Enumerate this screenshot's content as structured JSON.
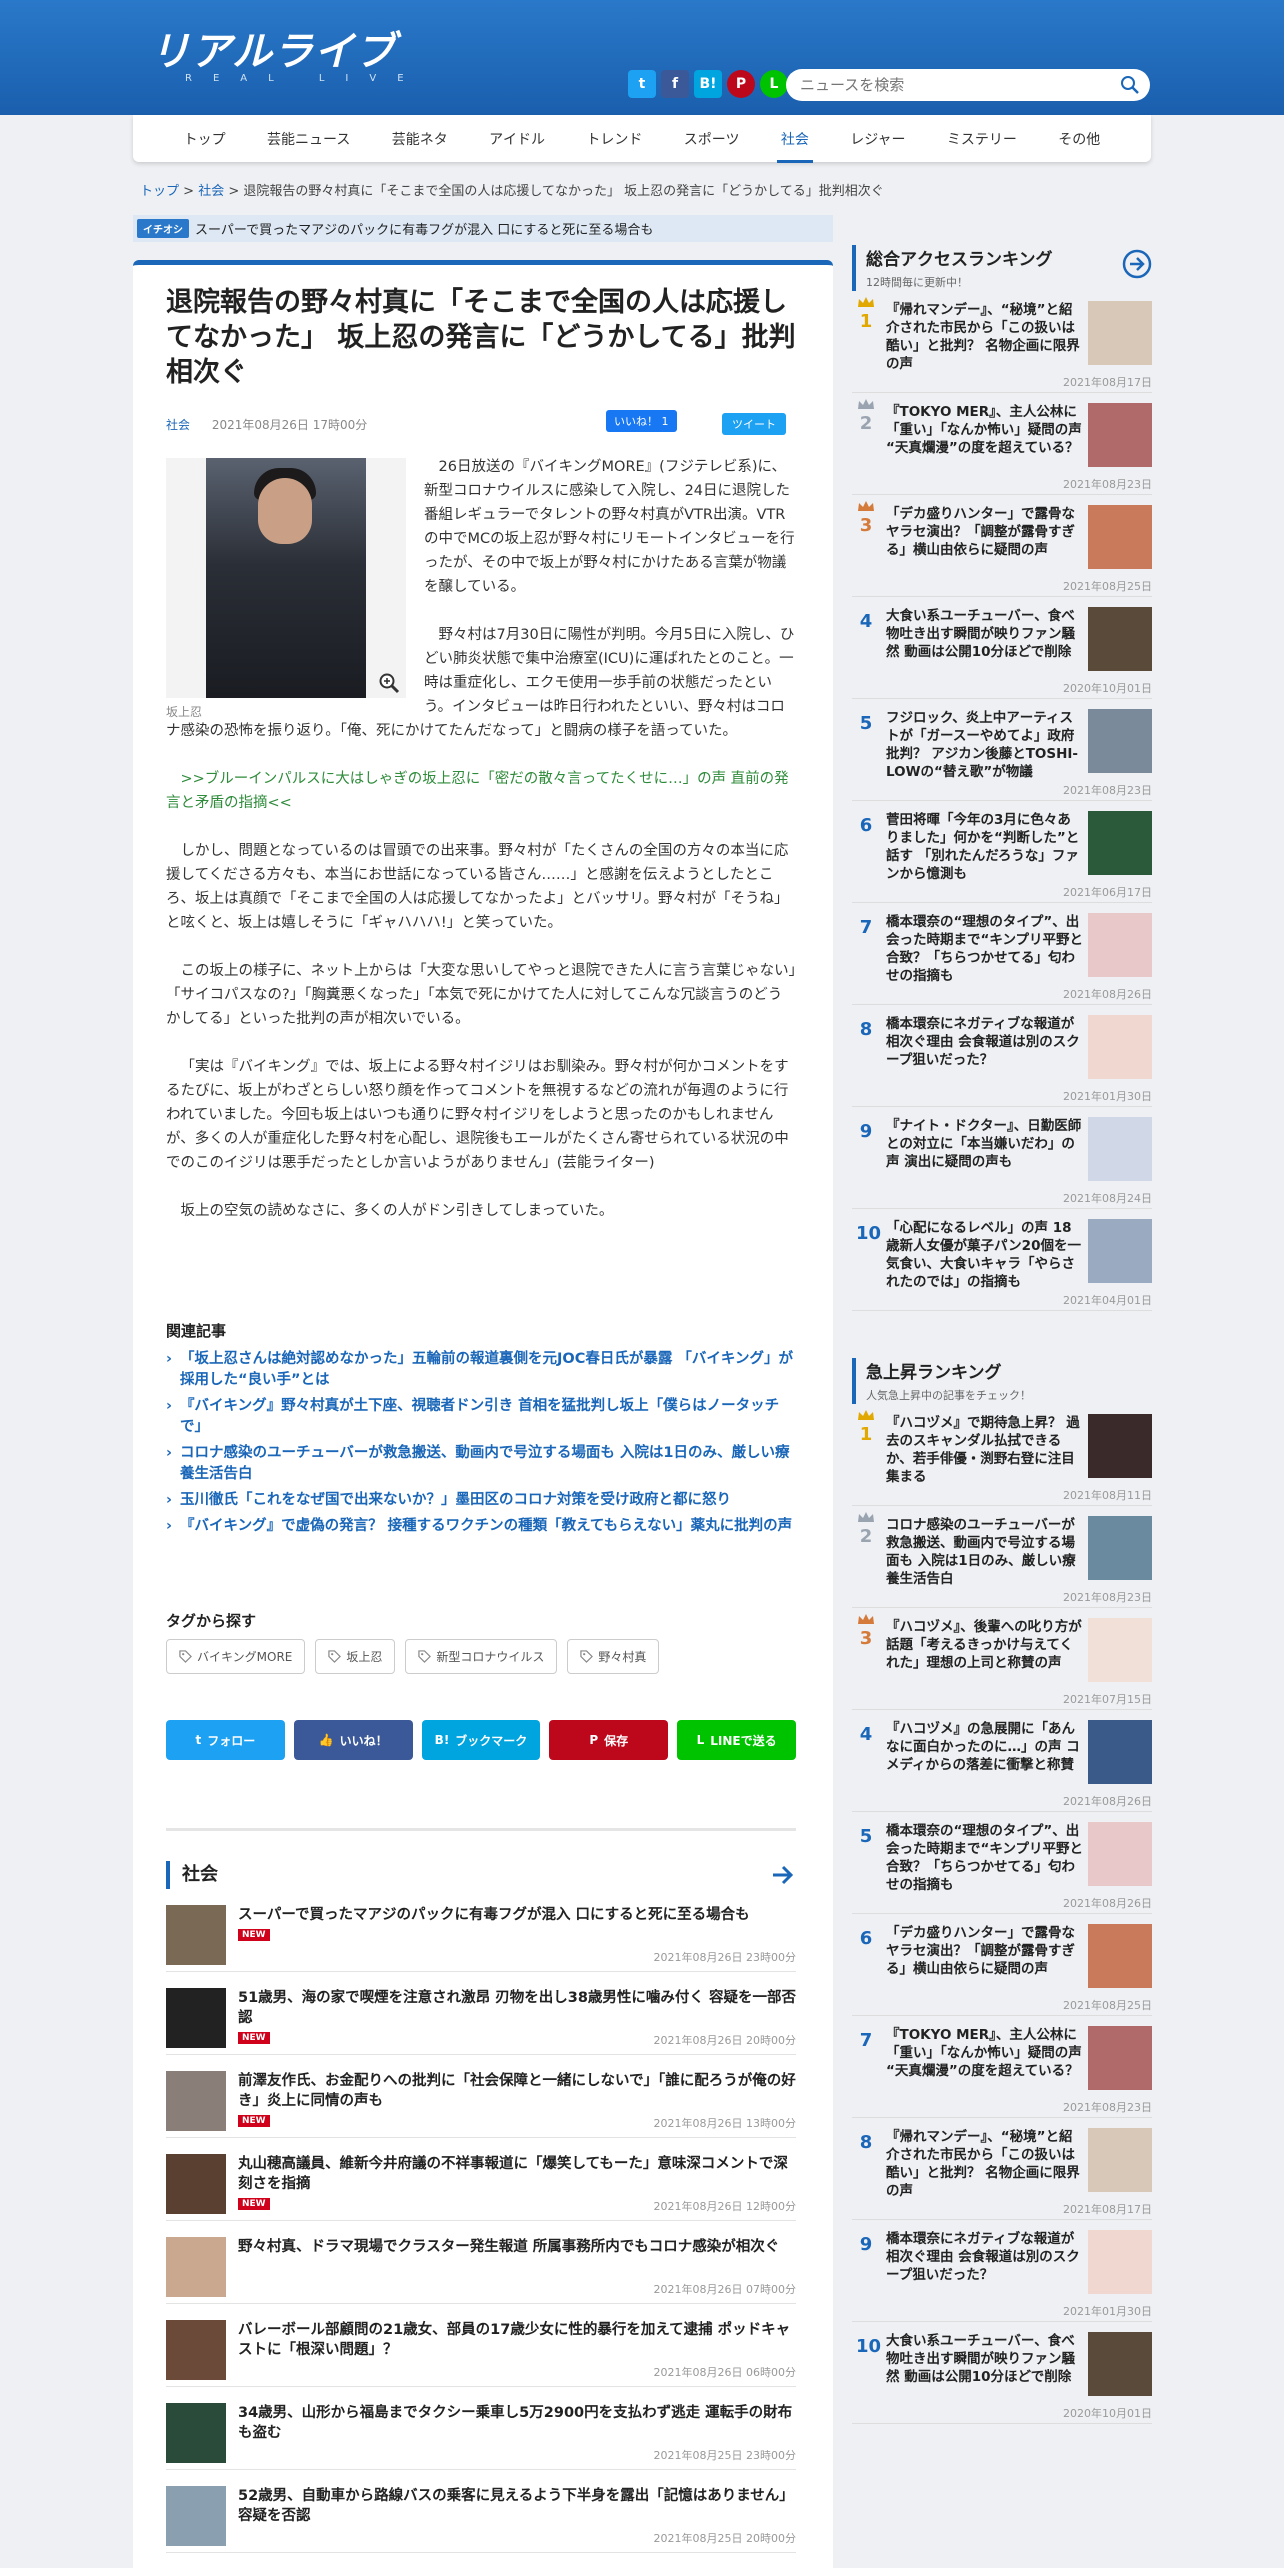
{
  "site": {
    "logo": "リアルライブ",
    "logo_sub": "REAL LIVE"
  },
  "search": {
    "placeholder": "ニュースを検索"
  },
  "social_top": [
    {
      "name": "twitter",
      "glyph": "t",
      "color": "#1da1f2"
    },
    {
      "name": "facebook",
      "glyph": "f",
      "color": "#3b5998"
    },
    {
      "name": "hatena",
      "glyph": "B!",
      "color": "#00a4de"
    },
    {
      "name": "pinterest",
      "glyph": "P",
      "color": "#bd081c"
    },
    {
      "name": "line",
      "glyph": "L",
      "color": "#00c300"
    }
  ],
  "nav": [
    "トップ",
    "芸能ニュース",
    "芸能ネタ",
    "アイドル",
    "トレンド",
    "スポーツ",
    "社会",
    "レジャー",
    "ミステリー",
    "その他"
  ],
  "nav_active": 6,
  "breadcrumb": {
    "top": "トップ",
    "sep1": " > ",
    "section": "社会",
    "sep2": " > ",
    "current": "退院報告の野々村真に「そこまで全国の人は応援してなかった」 坂上忍の発言に「どうかしてる」批判相次ぐ"
  },
  "pickup": {
    "label": "イチオシ",
    "text": "スーパーで買ったマアジのパックに有毒フグが混入 口にすると死に至る場合も"
  },
  "article": {
    "title": "退院報告の野々村真に「そこまで全国の人は応援してなかった」 坂上忍の発言に「どうかしてる」批判相次ぐ",
    "category": "社会",
    "date": "2021年08月26日 17時00分",
    "like_label": "いいね！ 1",
    "tweet_label": "ツイート",
    "photo_caption": "坂上忍",
    "paragraphs": [
      "26日放送の『バイキングMORE』(フジテレビ系)に、新型コロナウイルスに感染して入院し、24日に退院した番組レギュラーでタレントの野々村真がVTR出演。VTRの中でMCの坂上忍が野々村にリモートインタビューを行ったが、その中で坂上が野々村にかけたある言葉が物議を醸している。",
      "野々村は7月30日に陽性が判明。今月5日に入院し、ひどい肺炎状態で集中治療室(ICU)に運ばれたとのこと。一時は重症化し、エクモ使用一歩手前の状態だったという。インタビューは昨日行われたといい、野々村はコロナ感染の恐怖を振り返り。「俺、死にかけてたんだなって」と闘病の様子を語っていた。",
      "しかし、問題となっているのは冒頭での出来事。野々村が「たくさんの全国の方々の本当に応援してくださる方々も、本当にお世話になっている皆さん……」と感謝を伝えようとしたところ、坂上は真顔で「そこまで全国の人は応援してなかったよ」とバッサリ。野々村が「そうね」と呟くと、坂上は嬉しそうに「ギャハハハ!」と笑っていた。",
      "この坂上の様子に、ネット上からは「大変な思いしてやっと退院できた人に言う言葉じゃない」「サイコパスなの?」「胸糞悪くなった」「本気で死にかけてた人に対してこんな冗談言うのどうかしてる」といった批判の声が相次いでいる。",
      "「実は『バイキング』では、坂上による野々村イジリはお馴染み。野々村が何かコメントをするたびに、坂上がわざとらしい怒り顔を作ってコメントを無視するなどの流れが毎週のように行われていました。今回も坂上はいつも通りに野々村イジリをしようと思ったのかもしれませんが、多くの人が重症化した野々村を心配し、退院後もエールがたくさん寄せられている状況の中でのこのイジリは悪手だったとしか言いようがありません」(芸能ライター)",
      "坂上の空気の読めなさに、多くの人がドン引きしてしまっていた。"
    ],
    "inline_link": ">>ブルーインパルスに大はしゃぎの坂上忍に「密だの散々言ってたくせに…」の声 直前の発言と矛盾の指摘<<"
  },
  "related": {
    "heading": "関連記事",
    "items": [
      "「坂上忍さんは絶対認めなかった」五輪前の報道裏側を元JOC春日氏が暴露 「バイキング」が採用した“良い手”とは",
      "『バイキング』野々村真が土下座、視聴者ドン引き 首相を猛批判し坂上「僕らはノータッチで」",
      "コロナ感染のユーチューバーが救急搬送、動画内で号泣する場面も 入院は1日のみ、厳しい療養生活告白",
      "玉川徹氏「これをなぜ国で出来ないか？」墨田区のコロナ対策を受け政府と都に怒り",
      "『バイキング』で虚偽の発言？ 接種するワクチンの種類「教えてもらえない」薬丸に批判の声"
    ]
  },
  "tags": {
    "heading": "タグから探す",
    "items": [
      "バイキングMORE",
      "坂上忍",
      "新型コロナウイルス",
      "野々村真"
    ]
  },
  "share": [
    {
      "label": "フォロー",
      "color": "#1da1f2",
      "icon": "twitter-icon",
      "glyph": "t"
    },
    {
      "label": "いいね！",
      "color": "#3b5998",
      "icon": "thumbs-up-icon",
      "glyph": "👍"
    },
    {
      "label": "ブックマーク",
      "color": "#00a4de",
      "icon": "hatena-icon",
      "glyph": "B!"
    },
    {
      "label": "保存",
      "color": "#bd081c",
      "icon": "pinterest-icon",
      "glyph": "P"
    },
    {
      "label": "LINEで送る",
      "color": "#00c300",
      "icon": "line-icon",
      "glyph": "L"
    }
  ],
  "section": {
    "heading": "社会",
    "items": [
      {
        "title": "スーパーで買ったマアジのパックに有毒フグが混入 口にすると死に至る場合も",
        "date": "2021年08月26日 23時00分",
        "new": "NEW",
        "color": "#7a6a55"
      },
      {
        "title": "51歳男、海の家で喫煙を注意され激昂 刃物を出し38歳男性に噛み付く 容疑を一部否認",
        "date": "2021年08月26日 20時00分",
        "new": "NEW",
        "color": "#222222"
      },
      {
        "title": "前澤友作氏、お金配りへの批判に「社会保障と一緒にしないで」「誰に配ろうが俺の好き」炎上に同情の声も",
        "date": "2021年08月26日 13時00分",
        "new": "NEW",
        "color": "#8a7f78"
      },
      {
        "title": "丸山穂高議員、維新今井府議の不祥事報道に「爆笑してもーた」意味深コメントで深刻さを指摘",
        "date": "2021年08月26日 12時00分",
        "new": "NEW",
        "color": "#5a4030"
      },
      {
        "title": "野々村真、ドラマ現場でクラスター発生報道 所属事務所内でもコロナ感染が相次ぐ",
        "date": "2021年08月26日 07時00分",
        "new": "",
        "color": "#c9a88f"
      },
      {
        "title": "バレーボール部顧問の21歳女、部員の17歳少女に性的暴行を加えて逮捕 ポッドキャストに「根深い問題」？",
        "date": "2021年08月26日 06時00分",
        "new": "",
        "color": "#6b4a3a"
      },
      {
        "title": "34歳男、山形から福島までタクシー乗車し5万2900円を支払わず逃走 運転手の財布も盗む",
        "date": "2021年08月25日 23時00分",
        "new": "",
        "color": "#2a4a3a"
      },
      {
        "title": "52歳男、自動車から路線バスの乗客に見えるよう下半身を露出「記憶はありません」容疑を否認",
        "date": "2021年08月25日 20時00分",
        "new": "",
        "color": "#8aa0b0"
      }
    ]
  },
  "ranking_access": {
    "title": "総合アクセスランキング",
    "subtitle": "12時間毎に更新中！",
    "items": [
      {
        "rank": "1",
        "title": "『帰れマンデー』、“秘境”と紹介された市民から「この扱いは酷い」と批判？ 名物企画に限界の声",
        "date": "2021年08月17日",
        "color": "#d8c8b8"
      },
      {
        "rank": "2",
        "title": "『TOKYO MER』、主人公林に「重い」「なんか怖い」疑問の声 “天真爛漫”の度を超えている？",
        "date": "2021年08月23日",
        "color": "#b06a6a"
      },
      {
        "rank": "3",
        "title": "「デカ盛りハンター」で露骨なヤラセ演出？「調整が露骨すぎる」横山由依らに疑問の声",
        "date": "2021年08月25日",
        "color": "#c87a5a"
      },
      {
        "rank": "4",
        "title": "大食い系ユーチューバー、食べ物吐き出す瞬間が映りファン騒然 動画は公開10分ほどで削除",
        "date": "2020年10月01日",
        "color": "#5a4a3a"
      },
      {
        "rank": "5",
        "title": "フジロック、炎上中アーティストが「ガースーやめてよ」政府批判？ アジカン後藤とTOSHI-LOWの“替え歌”が物議",
        "date": "2021年08月23日",
        "color": "#7a8a9a"
      },
      {
        "rank": "6",
        "title": "菅田将暉「今年の3月に色々ありました」何かを“判断した”と話す 「別れたんだろうな」ファンから憶測も",
        "date": "2021年06月17日",
        "color": "#2a5a3a"
      },
      {
        "rank": "7",
        "title": "橋本環奈の“理想のタイプ”、出会った時期まで“キンプリ平野と合致？「ちらつかせてる」匂わせの指摘も",
        "date": "2021年08月26日",
        "color": "#e8c8c8"
      },
      {
        "rank": "8",
        "title": "橋本環奈にネガティブな報道が相次ぐ理由 会食報道は別のスクープ狙いだった？",
        "date": "2021年01月30日",
        "color": "#f0d8d0"
      },
      {
        "rank": "9",
        "title": "『ナイト・ドクター』、日勤医師との対立に「本当嫌いだわ」の声 演出に疑問の声も",
        "date": "2021年08月24日",
        "color": "#d0d8e8"
      },
      {
        "rank": "10",
        "title": "「心配になるレベル」の声 18歳新人女優が菓子パン20個を一気食い、大食いキャラ「やらされたのでは」の指摘も",
        "date": "2021年04月01日",
        "color": "#9aaac0"
      }
    ]
  },
  "ranking_rise": {
    "title": "急上昇ランキング",
    "subtitle": "人気急上昇中の記事をチェック！",
    "items": [
      {
        "rank": "1",
        "title": "『ハコヅメ』で期待急上昇？ 過去のスキャンダル払拭できるか、若手俳優・渕野右登に注目集まる",
        "date": "2021年08月11日",
        "color": "#3a2a2a"
      },
      {
        "rank": "2",
        "title": "コロナ感染のユーチューバーが救急搬送、動画内で号泣する場面も 入院は1日のみ、厳しい療養生活告白",
        "date": "2021年08月23日",
        "color": "#6a8aa0"
      },
      {
        "rank": "3",
        "title": "『ハコヅメ』、後輩への叱り方が話題「考えるきっかけ与えてくれた」理想の上司と称賛の声",
        "date": "2021年07月15日",
        "color": "#f0e0d8"
      },
      {
        "rank": "4",
        "title": "『ハコヅメ』の急展開に「あんなに面白かったのに…」の声 コメディからの落差に衝撃と称賛",
        "date": "2021年08月26日",
        "color": "#3a5a8a"
      },
      {
        "rank": "5",
        "title": "橋本環奈の“理想のタイプ”、出会った時期まで“キンプリ平野と合致？「ちらつかせてる」匂わせの指摘も",
        "date": "2021年08月26日",
        "color": "#e8c8c8"
      },
      {
        "rank": "6",
        "title": "「デカ盛りハンター」で露骨なヤラセ演出？「調整が露骨すぎる」横山由依らに疑問の声",
        "date": "2021年08月25日",
        "color": "#c87a5a"
      },
      {
        "rank": "7",
        "title": "『TOKYO MER』、主人公林に「重い」「なんか怖い」疑問の声 “天真爛漫”の度を超えている？",
        "date": "2021年08月23日",
        "color": "#b06a6a"
      },
      {
        "rank": "8",
        "title": "『帰れマンデー』、“秘境”と紹介された市民から「この扱いは酷い」と批判？ 名物企画に限界の声",
        "date": "2021年08月17日",
        "color": "#d8c8b8"
      },
      {
        "rank": "9",
        "title": "橋本環奈にネガティブな報道が相次ぐ理由 会食報道は別のスクープ狙いだった？",
        "date": "2021年01月30日",
        "color": "#f0d8d0"
      },
      {
        "rank": "10",
        "title": "大食い系ユーチューバー、食べ物吐き出す瞬間が映りファン騒然 動画は公開10分ほどで削除",
        "date": "2020年10月01日",
        "color": "#5a4a3a"
      }
    ]
  }
}
